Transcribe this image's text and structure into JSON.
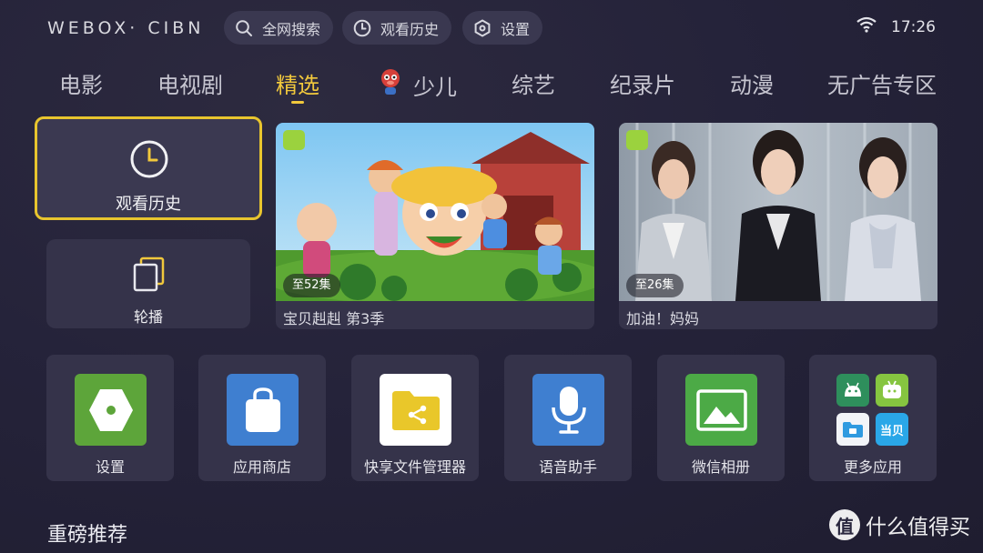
{
  "brand": "WEBOX· CIBN",
  "topbar": {
    "search_label": "全网搜索",
    "history_label": "观看历史",
    "settings_label": "设置",
    "time": "17:26"
  },
  "nav": {
    "items": [
      "电影",
      "电视剧",
      "精选",
      "少儿",
      "综艺",
      "纪录片",
      "动漫",
      "无广告专区"
    ],
    "active": "精选"
  },
  "tiles": {
    "history_label": "观看历史",
    "carousel_label": "轮播"
  },
  "cards": [
    {
      "badge": "至52集",
      "title": "宝贝赳赳 第3季"
    },
    {
      "badge": "至26集",
      "title": "加油！妈妈"
    }
  ],
  "apps": [
    {
      "label": "设置",
      "color": "#5da53a"
    },
    {
      "label": "应用商店",
      "color": "#3f7fd0"
    },
    {
      "label": "快享文件管理器",
      "color": "#ffffff"
    },
    {
      "label": "语音助手",
      "color": "#3f7fd0"
    },
    {
      "label": "微信相册",
      "color": "#4caa46"
    },
    {
      "label": "更多应用",
      "mini_apps": [
        "android",
        "tv-app",
        "folder",
        "当贝"
      ]
    }
  ],
  "section_title": "重磅推荐",
  "watermark": {
    "symbol": "值",
    "text": "什么值得买"
  },
  "colors": {
    "accent": "#f1c83c",
    "background": "#25233a",
    "tile": "#35334a"
  }
}
